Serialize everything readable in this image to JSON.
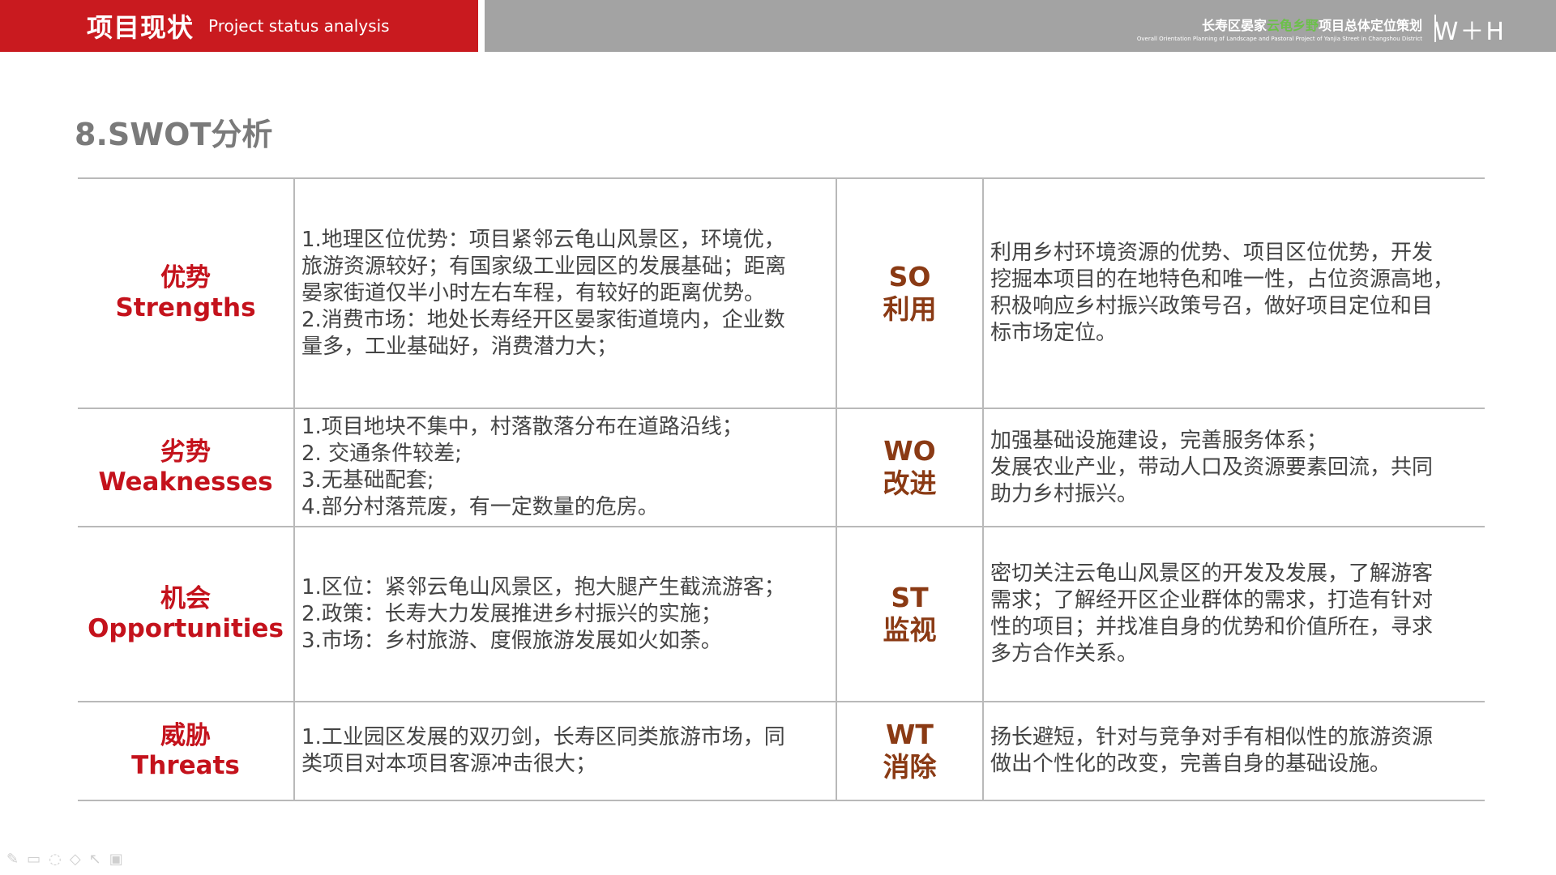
{
  "header": {
    "title": "项目现状",
    "subtitle": "Project status analysis",
    "project_name_part1": "长寿区晏家",
    "project_name_green": "云龟乡野",
    "project_name_part2": "项目总体定位策划",
    "project_name_en": "Overall Orientation Planning of Landscape and Pastoral Project of Yanjia Street in Changshou District",
    "logo": "W＋H"
  },
  "page_title": "8.SWOT分析",
  "rows": [
    {
      "label_cn": "优势",
      "label_en": "Strengths",
      "desc": [
        "1.地理区位优势：项目紧邻云龟山风景区，环境优，",
        "旅游资源较好；有国家级工业园区的发展基础；距离",
        "晏家街道仅半小时左右车程，有较好的距离优势。",
        "2.消费市场：地处长寿经开区晏家街道境内，企业数",
        "量多，工业基础好，消费潜力大；"
      ],
      "strategy_code": "SO",
      "strategy_cn": "利用",
      "strategy_desc": [
        "利用乡村环境资源的优势、项目区位优势，开发",
        "挖掘本项目的在地特色和唯一性，占位资源高地，",
        "积极响应乡村振兴政策号召，做好项目定位和目",
        "标市场定位。"
      ]
    },
    {
      "label_cn": "劣势",
      "label_en": "Weaknesses",
      "desc": [
        "1.项目地块不集中，村落散落分布在道路沿线；",
        "2. 交通条件较差;",
        "3.无基础配套;",
        "4.部分村落荒废，有一定数量的危房。"
      ],
      "strategy_code": "WO",
      "strategy_cn": "改进",
      "strategy_desc": [
        "加强基础设施建设，完善服务体系；",
        "发展农业产业，带动人口及资源要素回流，共同",
        "助力乡村振兴。"
      ]
    },
    {
      "label_cn": "机会",
      "label_en": "Opportunities",
      "desc": [
        "1.区位：紧邻云龟山风景区，抱大腿产生截流游客；",
        "2.政策：长寿大力发展推进乡村振兴的实施；",
        "3.市场：乡村旅游、度假旅游发展如火如荼。"
      ],
      "strategy_code": "ST",
      "strategy_cn": "监视",
      "strategy_desc": [
        "密切关注云龟山风景区的开发及发展，了解游客",
        "需求；了解经开区企业群体的需求，打造有针对",
        "性的项目；并找准自身的优势和价值所在，寻求",
        "多方合作关系。"
      ]
    },
    {
      "label_cn": "威胁",
      "label_en": "Threats",
      "desc": [
        "1.工业园区发展的双刃剑，长寿区同类旅游市场，同",
        "类项目对本项目客源冲击很大；"
      ],
      "strategy_code": "WT",
      "strategy_cn": "消除",
      "strategy_desc": [
        "扬长避短，针对与竞争对手有相似性的旅游资源",
        "做出个性化的改变，完善自身的基础设施。"
      ]
    }
  ],
  "toolbar": [
    "pen-icon",
    "highlighter-icon",
    "eraser-icon",
    "laser-icon",
    "pointer-icon",
    "screen-icon"
  ]
}
